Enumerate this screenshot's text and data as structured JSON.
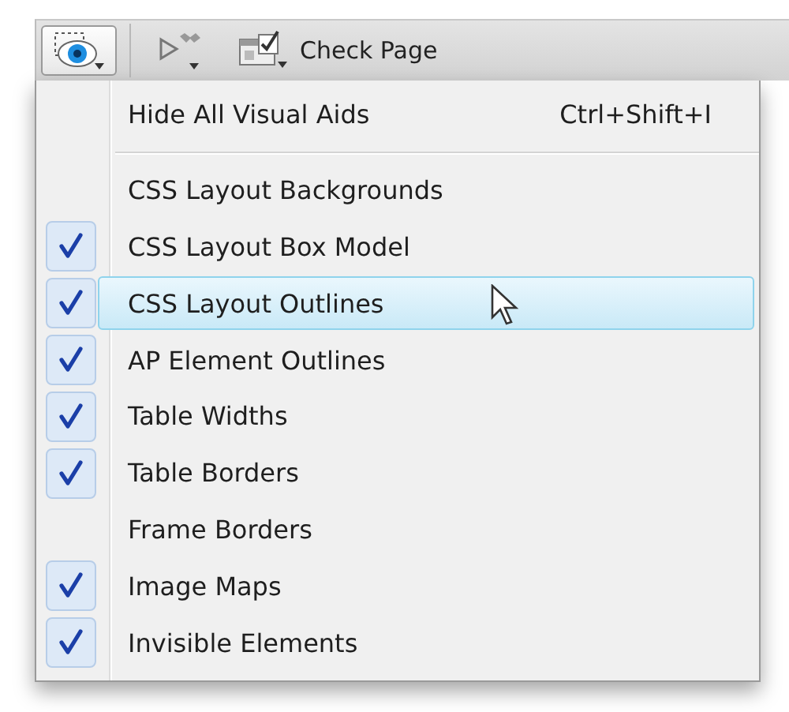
{
  "toolbar": {
    "buttons": [
      {
        "kind": "visual-aids",
        "selected": true
      },
      {
        "kind": "preview"
      },
      {
        "kind": "check",
        "label": "Check Page"
      }
    ]
  },
  "menu": {
    "items": [
      {
        "kind": "command",
        "label": "Hide All Visual Aids",
        "shortcut": "Ctrl+Shift+I"
      },
      {
        "kind": "separator"
      },
      {
        "kind": "toggle",
        "label": "CSS Layout Backgrounds",
        "checked": false,
        "selected": false
      },
      {
        "kind": "toggle",
        "label": "CSS Layout Box Model",
        "checked": true,
        "selected": false
      },
      {
        "kind": "toggle",
        "label": "CSS Layout Outlines",
        "checked": true,
        "selected": true
      },
      {
        "kind": "toggle",
        "label": "AP Element Outlines",
        "checked": true,
        "selected": false
      },
      {
        "kind": "toggle",
        "label": "Table Widths",
        "checked": true,
        "selected": false
      },
      {
        "kind": "toggle",
        "label": "Table Borders",
        "checked": true,
        "selected": false
      },
      {
        "kind": "toggle",
        "label": "Frame Borders",
        "checked": false,
        "selected": false
      },
      {
        "kind": "toggle",
        "label": "Image Maps",
        "checked": true,
        "selected": false
      },
      {
        "kind": "toggle",
        "label": "Invisible Elements",
        "checked": true,
        "selected": false
      }
    ]
  }
}
